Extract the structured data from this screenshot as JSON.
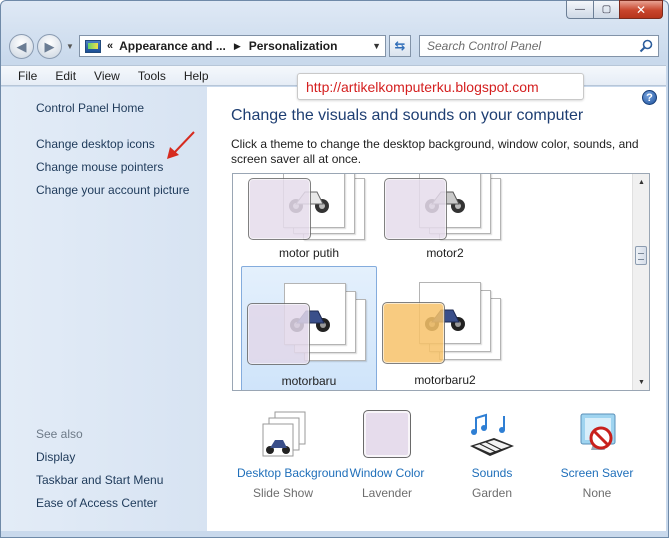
{
  "window": {
    "minimize": "—",
    "maximize": "▢",
    "close": "✕"
  },
  "nav": {
    "back": "◀",
    "forward": "▶"
  },
  "address": {
    "prefix": "«",
    "crumbs": [
      "Appearance and ...",
      "Personalization"
    ]
  },
  "search": {
    "placeholder": "Search Control Panel"
  },
  "menu": [
    "File",
    "Edit",
    "View",
    "Tools",
    "Help"
  ],
  "overlay": {
    "url": "http://artikelkomputerku.blogspot.com"
  },
  "sidebar": {
    "links": [
      "Control Panel Home",
      "Change desktop icons",
      "Change mouse pointers",
      "Change your account picture"
    ],
    "see_also_label": "See also",
    "see_also": [
      "Display",
      "Taskbar and Start Menu",
      "Ease of Access Center"
    ]
  },
  "main": {
    "help": "?",
    "title": "Change the visuals and sounds on your computer",
    "description": "Click a theme to change the desktop background, window color, sounds, and screen saver all at once.",
    "themes": [
      {
        "name": "motor putih",
        "color": "#e6dcec",
        "selected": false
      },
      {
        "name": "motor2",
        "color": "#e6dcec",
        "selected": false
      },
      {
        "name": "motorbaru",
        "color": "#e2d8ea",
        "selected": true
      },
      {
        "name": "motorbaru2",
        "color": "#f7c36a",
        "selected": false
      }
    ]
  },
  "settings": [
    {
      "label": "Desktop Background",
      "value": "Slide Show",
      "icon": "desktop-background-icon"
    },
    {
      "label": "Window Color",
      "value": "Lavender",
      "icon": "window-color-icon",
      "color": "#e6dcec"
    },
    {
      "label": "Sounds",
      "value": "Garden",
      "icon": "sounds-icon"
    },
    {
      "label": "Screen Saver",
      "value": "None",
      "icon": "screen-saver-icon"
    }
  ]
}
